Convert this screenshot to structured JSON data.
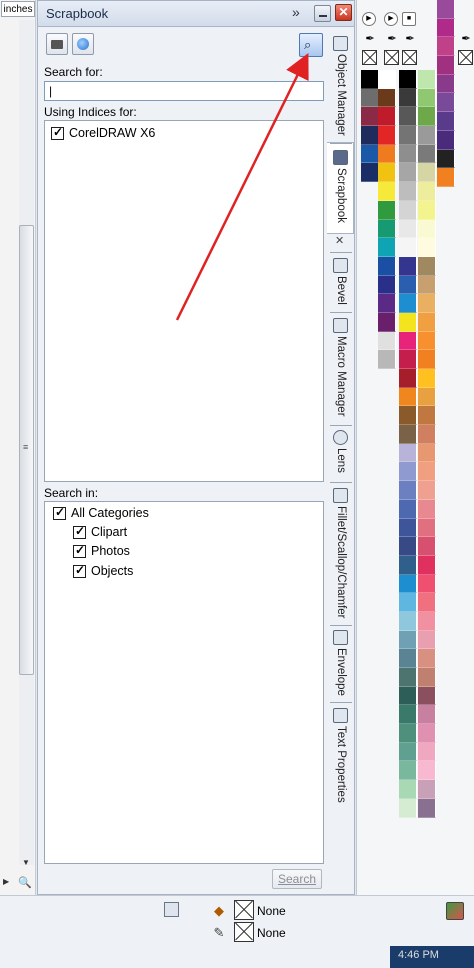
{
  "ruler": {
    "units": "inches",
    "scroll_grip": "≡"
  },
  "docker": {
    "title": "Scrapbook",
    "expand_glyph": "»",
    "close_glyph": "✕",
    "search_for_label": "Search for:",
    "search_value": "|",
    "using_indices_label": "Using Indices for:",
    "indices": [
      {
        "label": "CorelDRAW X6",
        "checked": true
      }
    ],
    "search_in_label": "Search in:",
    "categories": [
      {
        "label": "All Categories",
        "checked": true,
        "level": 0
      },
      {
        "label": "Clipart",
        "checked": true,
        "level": 1
      },
      {
        "label": "Photos",
        "checked": true,
        "level": 1
      },
      {
        "label": "Objects",
        "checked": true,
        "level": 1
      }
    ],
    "search_button": "Search",
    "find_glyph": "⌕"
  },
  "tabs": [
    {
      "label": "Object Manager"
    },
    {
      "label": "Scrapbook"
    },
    {
      "label": "Bevel"
    },
    {
      "label": "Macro Manager"
    },
    {
      "label": "Lens"
    },
    {
      "label": "Fillet/Scallop/Chamfer"
    },
    {
      "label": "Envelope"
    },
    {
      "label": "Text Properties"
    }
  ],
  "tab_close_glyph": "✕",
  "palettes": {
    "col1": [
      "#000000",
      "#6d6d6d",
      "#8b2a46",
      "#1f2b5b",
      "#1a58a8",
      "#1b2d66"
    ],
    "col2": [
      "#ffffff",
      "#6b3a1a",
      "#c01b2a",
      "#e22525",
      "#f07a1e",
      "#f0c312",
      "#f6e93a",
      "#2f9a3e",
      "#159a72",
      "#0ea4b4",
      "#1a4fa4",
      "#2a2f8a",
      "#5b2a86",
      "#6a1f6a",
      "#e0e0e0",
      "#b8b8b8"
    ],
    "col3": [
      "#000000",
      "#3a3a3a",
      "#585858",
      "#747474",
      "#8e8e8e",
      "#a6a6a6",
      "#bdbdbd",
      "#d4d4d4",
      "#e8e8e8",
      "#f5f5f5",
      "#33358f",
      "#2a5fb0",
      "#1d8fd0",
      "#f4e41e",
      "#e8247a",
      "#c41f4c",
      "#a61e2a",
      "#f0861e",
      "#8a5a2b",
      "#7a6248",
      "#b7b3d9",
      "#8f9bd0",
      "#6c7fc0",
      "#4f69b0",
      "#3f559a",
      "#384a86",
      "#2f5f8a",
      "#1d8fd0",
      "#5fb6e0",
      "#8fc8dc",
      "#6fa0b4",
      "#5a8494",
      "#4e7470",
      "#2d5e58",
      "#3a7a6a",
      "#4f907c",
      "#5fa090",
      "#79b89c",
      "#a9d8b4",
      "#d6ecd2"
    ],
    "col4": [
      "#bfe7ad",
      "#8fc870",
      "#6da84b",
      "#9a9a9a",
      "#7a7a7a",
      "#d6d6a4",
      "#eded9d",
      "#f4f48e",
      "#fafad2",
      "#fffbe0",
      "#a08860",
      "#c8a070",
      "#e8b060",
      "#f0a040",
      "#f89030",
      "#f08020",
      "#ffc020",
      "#e8a040",
      "#c07840",
      "#d08060",
      "#e89870",
      "#f0a080",
      "#f0a090",
      "#e88890",
      "#e07080",
      "#d85070",
      "#e03060",
      "#f05070",
      "#f07080",
      "#f090a0",
      "#e8a0b0",
      "#d89080",
      "#c08070",
      "#8a5060",
      "#c880a0",
      "#e090b0",
      "#f0a8c0",
      "#f8b8d0",
      "#c8a0b8",
      "#8a7090"
    ],
    "col5": [
      "#9a4a9a",
      "#b02a8a",
      "#c0408a",
      "#a03080",
      "#8a3a8a",
      "#7a4a9a",
      "#5a3a8a",
      "#4a2a7a",
      "#222222",
      "#f08020"
    ]
  },
  "status": {
    "fill_value": "None",
    "outline_value": "None",
    "clock": "4:46 PM"
  }
}
